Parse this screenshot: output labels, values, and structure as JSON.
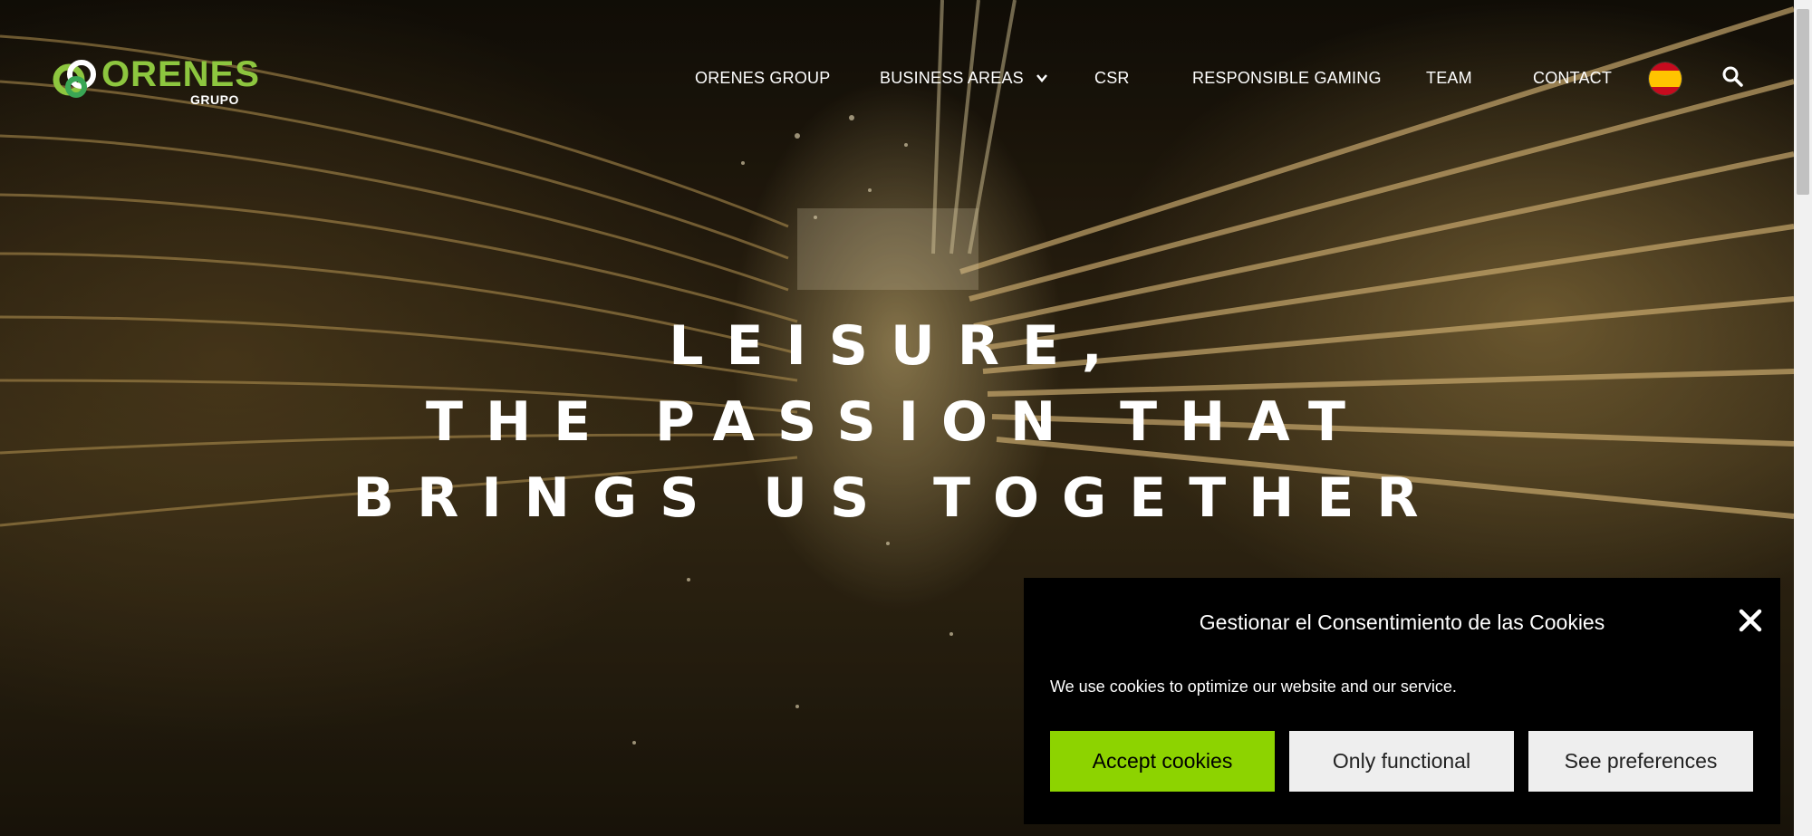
{
  "brand": {
    "name": "ORENES",
    "sub": "GRUPO",
    "accent_color": "#8dc63f"
  },
  "nav": {
    "items": [
      {
        "label": "ORENES GROUP"
      },
      {
        "label": "BUSINESS AREAS",
        "has_dropdown": true
      },
      {
        "label": "CSR"
      },
      {
        "label": "RESPONSIBLE GAMING"
      },
      {
        "label": "TEAM"
      },
      {
        "label": "CONTACT"
      }
    ],
    "language_icon": "spain-flag-icon",
    "search_icon": "search-icon"
  },
  "hero": {
    "lines": [
      "LEISURE,",
      "THE PASSION THAT",
      "BRINGS US TOGETHER"
    ]
  },
  "cookie": {
    "title": "Gestionar el Consentimiento de las Cookies",
    "text": "We use cookies to optimize our website and our service.",
    "accept_label": "Accept cookies",
    "functional_label": "Only functional",
    "preferences_label": "See preferences",
    "close_icon": "close-icon",
    "accept_color": "#8dd300"
  }
}
